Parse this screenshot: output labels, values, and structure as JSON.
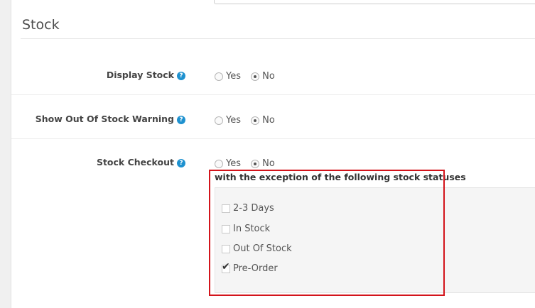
{
  "section": {
    "title": "Stock"
  },
  "rows": [
    {
      "label": "Display Stock",
      "options": [
        "Yes",
        "No"
      ],
      "selected": "No"
    },
    {
      "label": "Show Out Of Stock Warning",
      "options": [
        "Yes",
        "No"
      ],
      "selected": "No"
    },
    {
      "label": "Stock Checkout",
      "options": [
        "Yes",
        "No"
      ],
      "selected": "No"
    }
  ],
  "help_icon": {
    "glyph": "?"
  },
  "exceptions": {
    "heading": "with the exception of the following stock statuses",
    "statuses": [
      {
        "label": "2-3 Days",
        "checked": false
      },
      {
        "label": "In Stock",
        "checked": false
      },
      {
        "label": "Out Of Stock",
        "checked": false
      },
      {
        "label": "Pre-Order",
        "checked": true
      }
    ]
  },
  "colors": {
    "help_icon": "#1e91cf",
    "highlight_border": "#d3141b"
  }
}
